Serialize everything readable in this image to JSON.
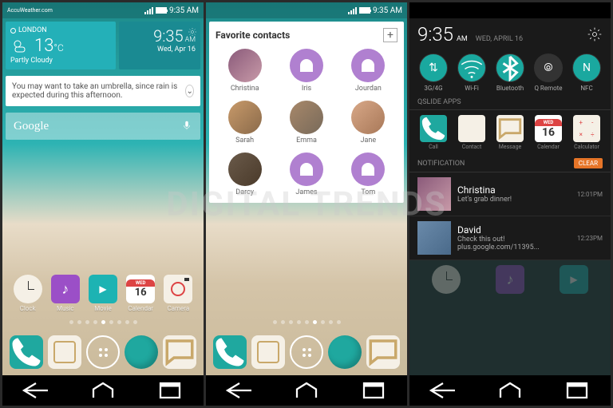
{
  "watermark": "DIGITAL TRENDS",
  "status": {
    "time": "9:35 AM"
  },
  "weather": {
    "location": "LONDON",
    "temp": "13",
    "unit": "°C",
    "desc": "Partly Cloudy",
    "source": "AccuWeather.com"
  },
  "clock": {
    "time": "9:35",
    "ampm": "AM",
    "date": "Wed, Apr 16"
  },
  "tip": "You may want to take an umbrella, since rain is expected during this afternoon.",
  "search": {
    "logo": "Google"
  },
  "apps": [
    {
      "label": "Clock"
    },
    {
      "label": "Music"
    },
    {
      "label": "Movie"
    },
    {
      "label": "Calendar",
      "day": "16",
      "dow": "WED"
    },
    {
      "label": "Camera"
    }
  ],
  "favorites": {
    "title": "Favorite contacts",
    "contacts": [
      "Christina",
      "Iris",
      "Jourdan",
      "Sarah",
      "Emma",
      "Jane",
      "Darcy",
      "James",
      "Tom"
    ]
  },
  "panel": {
    "time": "9:35",
    "ampm": "AM",
    "date": "WED, APRIL 16",
    "toggles": [
      "3G/4G",
      "Wi-Fi",
      "Bluetooth",
      "Q Remote",
      "NFC"
    ],
    "qslide_title": "QSLIDE APPS",
    "qslide": [
      "Call",
      "Contact",
      "Message",
      "Calendar",
      "Calculator"
    ],
    "notif_title": "NOTIFICATION",
    "clear": "CLEAR",
    "notifs": [
      {
        "name": "Christina",
        "msg": "Let's grab dinner!",
        "time": "12:01PM"
      },
      {
        "name": "David",
        "msg": "Check this out! plus.google.com/11395...",
        "time": "12:23PM"
      }
    ]
  },
  "cal_day": "16",
  "cal_dow": "WED",
  "calc": {
    "a": "+",
    "b": "-",
    "c": "×",
    "d": "÷"
  }
}
